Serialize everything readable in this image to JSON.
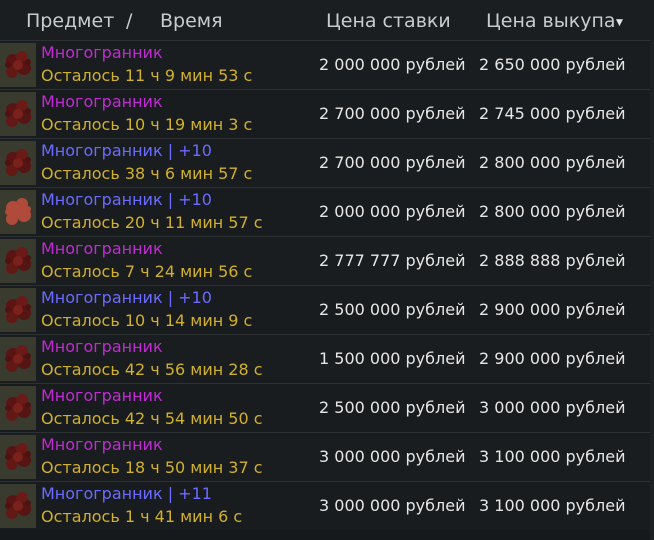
{
  "colors": {
    "purple_name": "#c12bd4",
    "blue_name": "#6b6bff",
    "time": "#d0b02c",
    "price": "#e6e6e6"
  },
  "header": {
    "item_label": "Предмет",
    "separator": "/",
    "time_label": "Время",
    "bid_label": "Цена ставки",
    "buyout_label": "Цена выкупа",
    "sort_icon": "sort-down-triangle-icon"
  },
  "rows": [
    {
      "name": "Многогранник",
      "rarity": "purple",
      "time_left": "Осталось 11 ч 9 мин 53 с",
      "bid": "2 000 000 рублей",
      "buyout": "2 650 000 рублей"
    },
    {
      "name": "Многогранник",
      "rarity": "purple",
      "time_left": "Осталось 10 ч 19 мин 3 с",
      "bid": "2 700 000 рублей",
      "buyout": "2 745 000 рублей"
    },
    {
      "name": "Многогранник | +10",
      "rarity": "blue",
      "time_left": "Осталось 38 ч 6 мин 57 с",
      "bid": "2 700 000 рублей",
      "buyout": "2 800 000 рублей"
    },
    {
      "name": "Многогранник | +10",
      "rarity": "blue",
      "time_left": "Осталось 20 ч 11 мин 57 с",
      "bid": "2 000 000 рублей",
      "buyout": "2 800 000 рублей"
    },
    {
      "name": "Многогранник",
      "rarity": "purple",
      "time_left": "Осталось 7 ч 24 мин 56 с",
      "bid": "2 777 777 рублей",
      "buyout": "2 888 888 рублей"
    },
    {
      "name": "Многогранник | +10",
      "rarity": "blue",
      "time_left": "Осталось 10 ч 14 мин 9 с",
      "bid": "2 500 000 рублей",
      "buyout": "2 900 000 рублей"
    },
    {
      "name": "Многогранник",
      "rarity": "purple",
      "time_left": "Осталось 42 ч 56 мин 28 с",
      "bid": "1 500 000 рублей",
      "buyout": "2 900 000 рублей"
    },
    {
      "name": "Многогранник",
      "rarity": "purple",
      "time_left": "Осталось 42 ч 54 мин 50 с",
      "bid": "2 500 000 рублей",
      "buyout": "3 000 000 рублей"
    },
    {
      "name": "Многогранник",
      "rarity": "purple",
      "time_left": "Осталось 18 ч 50 мин 37 с",
      "bid": "3 000 000 рублей",
      "buyout": "3 100 000 рублей"
    },
    {
      "name": "Многогранник | +11",
      "rarity": "blue",
      "time_left": "Осталось 1 ч 41 мин 6 с",
      "bid": "3 000 000 рублей",
      "buyout": "3 100 000 рублей"
    }
  ]
}
